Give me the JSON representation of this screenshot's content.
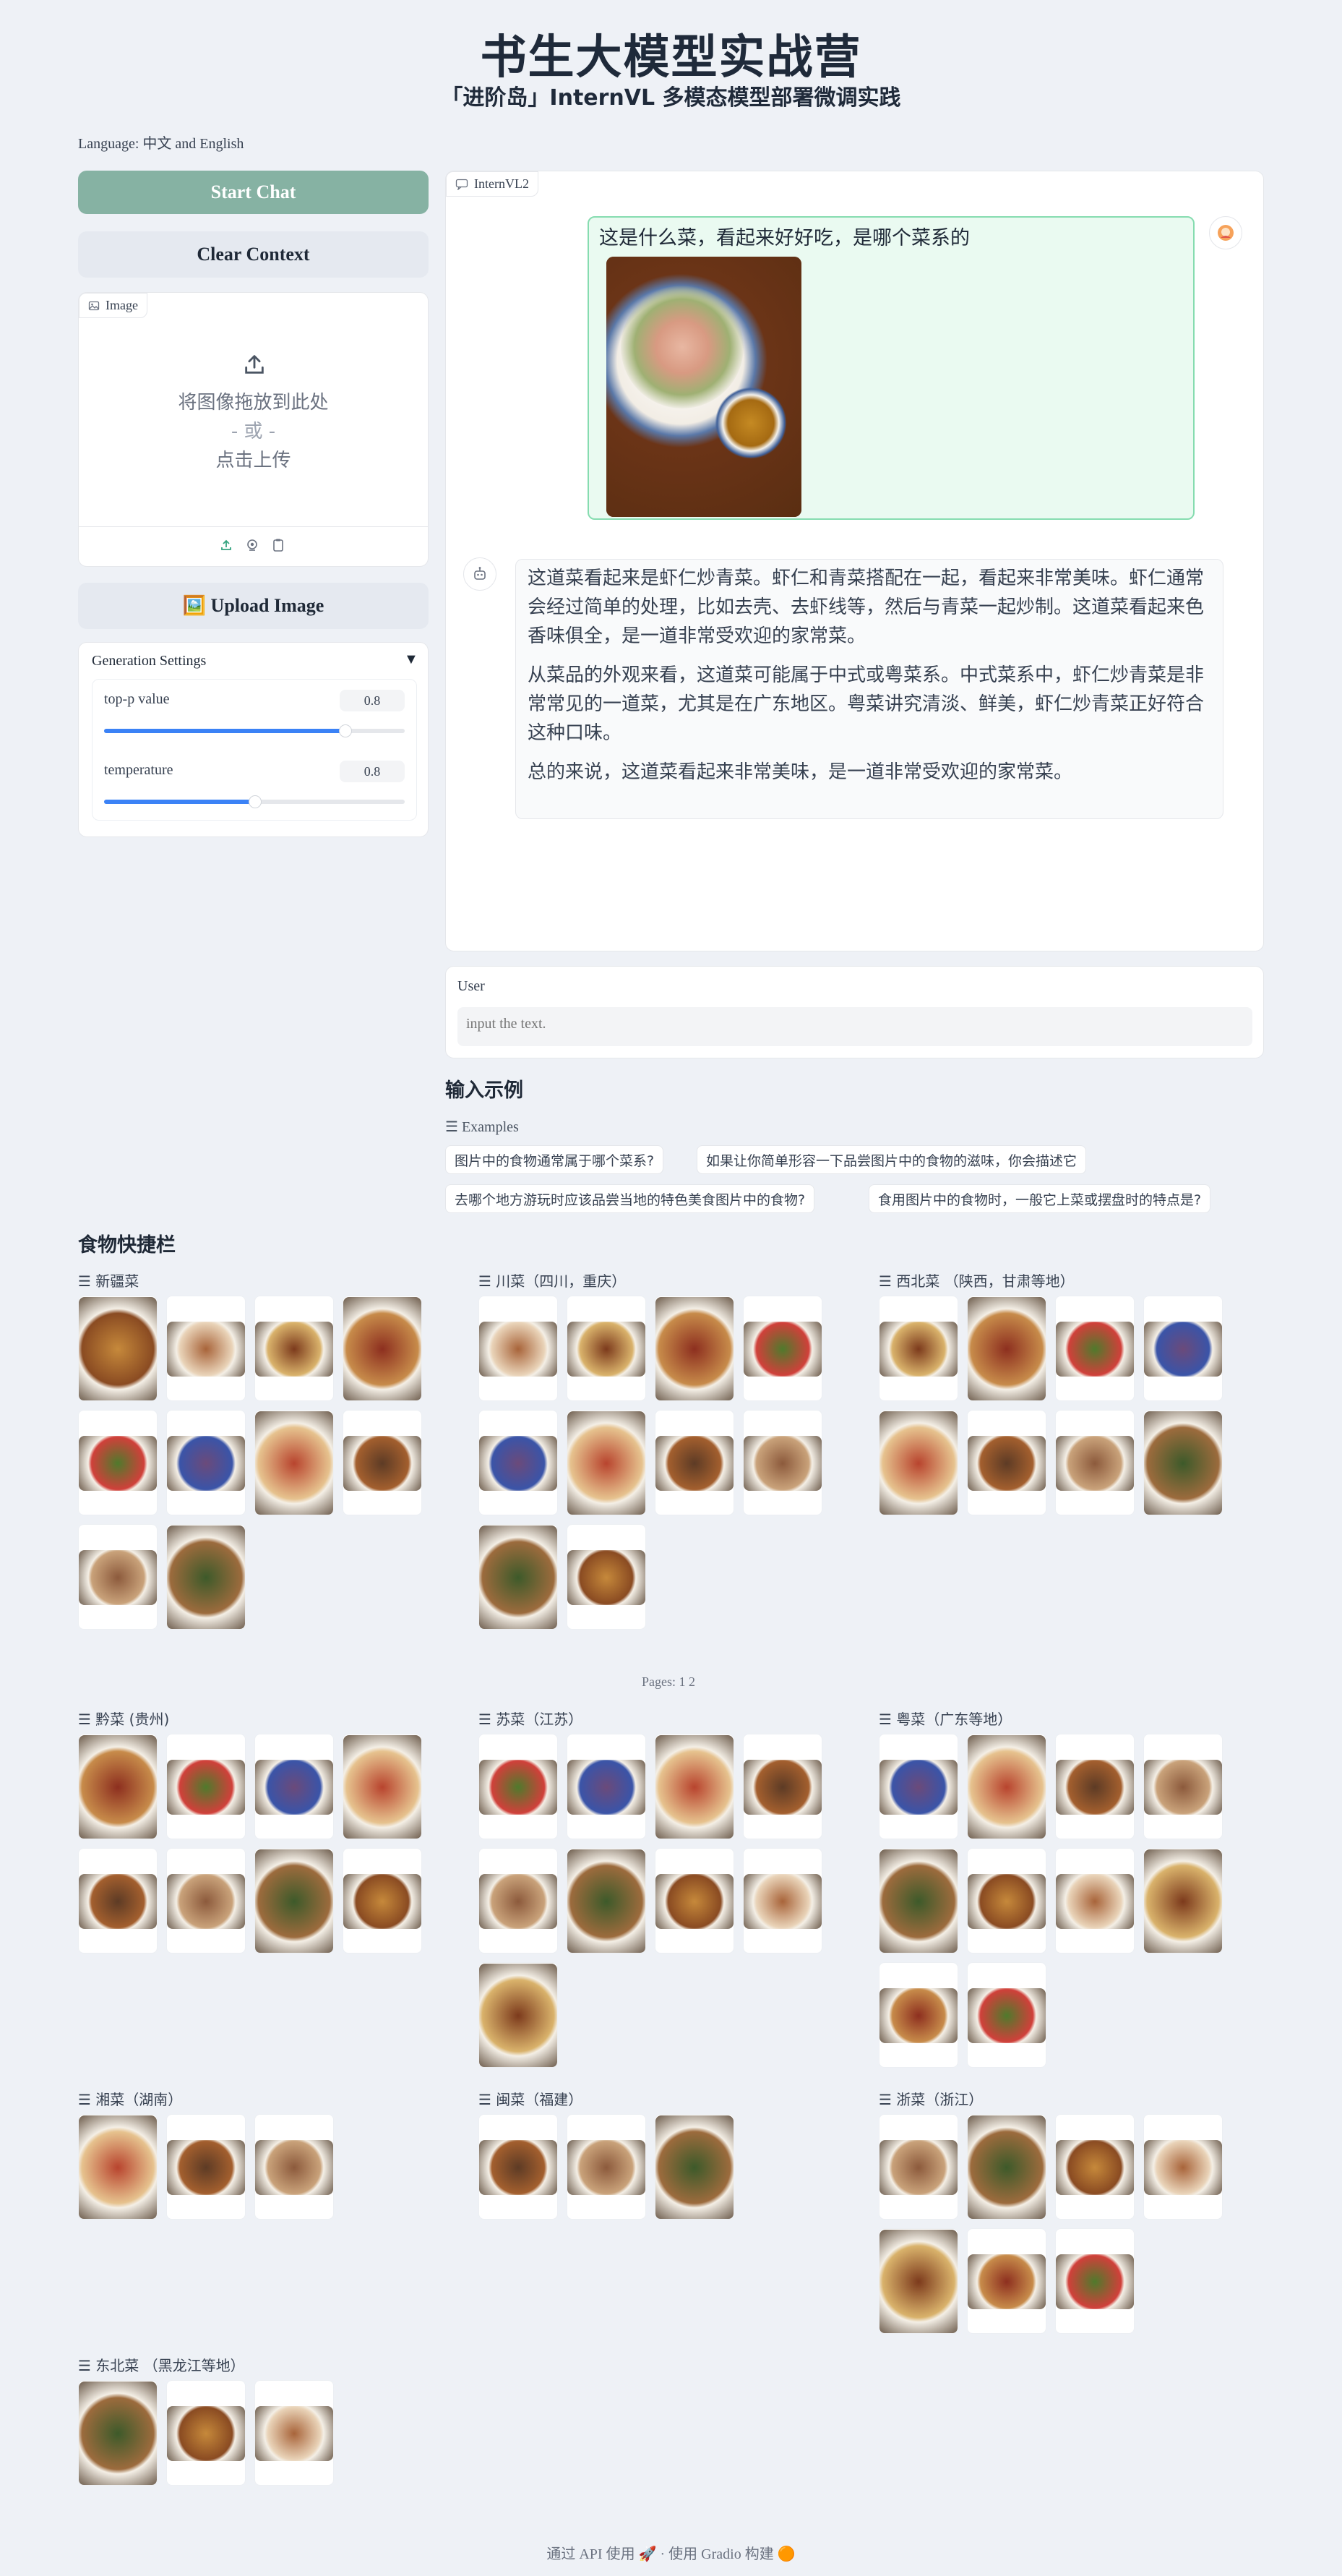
{
  "header": {
    "title": "书生大模型实战营",
    "subtitle": "「进阶岛」InternVL 多模态模型部署微调实践",
    "language": "Language: 中文 and English"
  },
  "sidebar": {
    "start_chat": "Start Chat",
    "clear_context": "Clear Context",
    "image_label": "Image",
    "drop_line1": "将图像拖放到此处",
    "drop_or": "- 或 -",
    "drop_line2": "点击上传",
    "upload_image": "🖼️ Upload Image",
    "gen_settings": "Generation Settings",
    "top_p_label": "top-p value",
    "top_p_value": "0.8",
    "top_p_fraction": 0.8,
    "temperature_label": "temperature",
    "temperature_value": "0.8",
    "temperature_fraction": 0.5
  },
  "chat": {
    "tab_label": "InternVL2",
    "user_message": "这是什么菜，看起来好好吃，是哪个菜系的",
    "bot_paragraphs": [
      "这道菜看起来是虾仁炒青菜。虾仁和青菜搭配在一起，看起来非常美味。虾仁通常会经过简单的处理，比如去壳、去虾线等，然后与青菜一起炒制。这道菜看起来色香味俱全，是一道非常受欢迎的家常菜。",
      "从菜品的外观来看，这道菜可能属于中式或粤菜系。中式菜系中，虾仁炒青菜是非常常见的一道菜，尤其是在广东地区。粤菜讲究清淡、鲜美，虾仁炒青菜正好符合这种口味。",
      "总的来说，这道菜看起来非常美味，是一道非常受欢迎的家常菜。"
    ]
  },
  "input": {
    "label": "User",
    "placeholder": "input the text."
  },
  "examples": {
    "heading": "输入示例",
    "label": "Examples",
    "items": [
      "图片中的食物通常属于哪个菜系?",
      "如果让你简单形容一下品尝图片中的食物的滋味，你会描述它",
      "去哪个地方游玩时应该品尝当地的特色美食图片中的食物?",
      "食用图片中的食物时，一般它上菜或摆盘时的特点是?"
    ]
  },
  "food_bar": {
    "heading": "食物快捷栏",
    "pages": "Pages: 1 2",
    "categories": [
      "新疆菜",
      "川菜（四川，重庆）",
      "西北菜 （陕西，甘肃等地）",
      "黔菜 (贵州)",
      "苏菜（江苏）",
      "粤菜（广东等地）",
      "湘菜（湖南）",
      "闽菜（福建）",
      "浙菜（浙江）",
      "东北菜 （黑龙江等地）"
    ]
  },
  "footer": {
    "api": "通过 API 使用",
    "dot": "·",
    "built": "使用 Gradio 构建"
  }
}
